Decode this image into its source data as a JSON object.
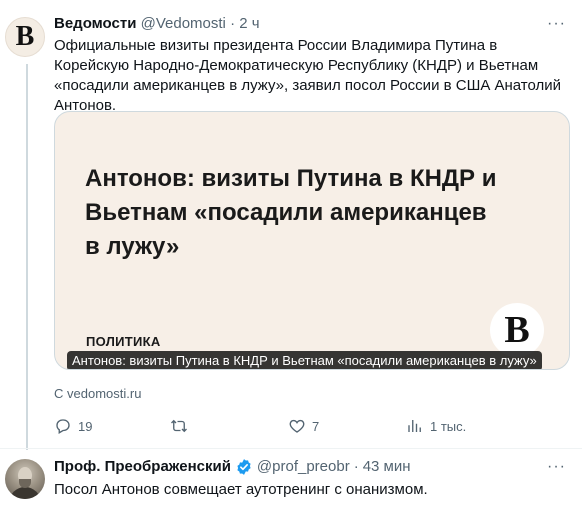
{
  "tweet1": {
    "avatar_letter": "B",
    "author_name": "Ведомости",
    "author_handle": "@Vedomosti",
    "separator": "·",
    "time": "2 ч",
    "more_icon": "···",
    "text": "Официальные визиты президента России Владимира Путина в Корейскую Народно-Демократическую Республику (КНДР) и Вьетнам «посадили американцев в лужу», заявил посол России в США Анатолий Антонов.",
    "card": {
      "headline": "Антонов: визиты Путина в КНДР и Вьетнам «посадили американцев в лужу»",
      "rubric": "ПОЛИТИКА",
      "logo_letter": "B",
      "caption": "Антонов: визиты Путина в КНДР и Вьетнам «посадили американцев в лужу»",
      "background": "#f7efe7"
    },
    "source": "С vedomosti.ru",
    "actions": {
      "reply_count": "19",
      "retweet_count": "",
      "like_count": "7",
      "views_count": "1 тыс."
    }
  },
  "tweet2": {
    "author_name": "Проф. Преображенский",
    "author_handle": "@prof_preobr",
    "separator": "·",
    "time": "43 мин",
    "more_icon": "···",
    "verified_color": "#1d9bf0",
    "text": "Посол Антонов совмещает аутотренинг с онанизмом."
  },
  "colors": {
    "text_primary": "#0f1419",
    "text_secondary": "#536471",
    "border": "#cfd9de"
  }
}
